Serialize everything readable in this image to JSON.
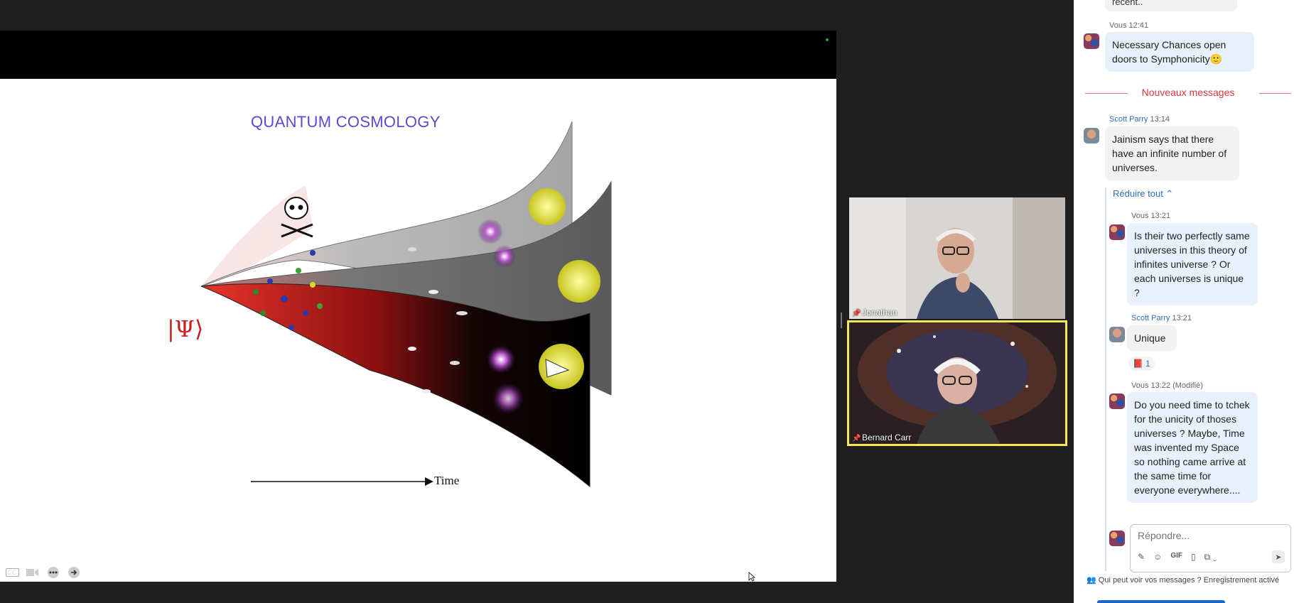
{
  "slide": {
    "title": "QUANTUM COSMOLOGY",
    "psi_symbol": "|Ψ⟩",
    "time_label": "Time"
  },
  "share_toolbar": {
    "cc": "CC"
  },
  "videos": [
    {
      "name": "Jonathan"
    },
    {
      "name": "Bernard Carr"
    }
  ],
  "chat": {
    "top_stub": "récent..",
    "messages": [
      {
        "author": "Vous",
        "time": "12:41",
        "text": "Necessary Chances open doors to Symphonicity🙂"
      },
      {
        "author": "Scott Parry",
        "time": "13:14",
        "text": "Jainism says that there have an infinite number of universes."
      }
    ],
    "new_messages_label": "Nouveaux messages",
    "collapse_label": "Réduire tout ⌃",
    "thread": [
      {
        "author": "Vous",
        "time": "13:21",
        "text": "Is their two perfectly same universes in this theory of infinites universe ? Or each universes is unique ?"
      },
      {
        "author": "Scott Parry",
        "time": "13:21",
        "text": "Unique"
      },
      {
        "author": "Vous",
        "time": "13:22 (Modifié)",
        "text": "Do you need time to tchek for the unicity of thoses universes ? Maybe, Time was invented my Space so nothing came arrive at the same time for everyone everywhere...."
      }
    ],
    "reaction_count": "1",
    "reply_placeholder": "Répondre...",
    "gif_label": "GIF",
    "footer": "Qui peut voir vos messages ? Enregistrement activé"
  }
}
